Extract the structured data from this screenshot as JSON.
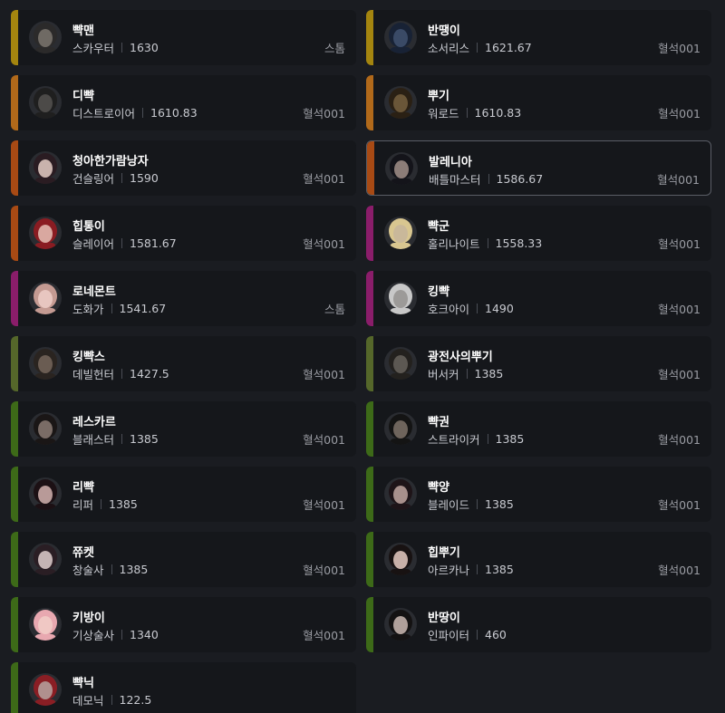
{
  "colors": {
    "tier_gold": "#a4850f",
    "tier_orange": "#b1691a",
    "tier_rust": "#a84a14",
    "tier_purple": "#8a1d6a",
    "tier_olive": "#55672a",
    "tier_green": "#3d6a18"
  },
  "characters": [
    {
      "name": "뺙맨",
      "class": "스카우터",
      "level": "1630",
      "guild": "스톰",
      "tier": "tier_gold",
      "avatar_tone": "#6f6a64",
      "avatar_hair": "#2b2a2a",
      "selected": false
    },
    {
      "name": "반땡이",
      "class": "소서리스",
      "level": "1621.67",
      "guild": "혈석001",
      "tier": "tier_gold",
      "avatar_tone": "#3a4a66",
      "avatar_hair": "#182235",
      "selected": false
    },
    {
      "name": "디뺙",
      "class": "디스트로이어",
      "level": "1610.83",
      "guild": "혈석001",
      "tier": "tier_orange",
      "avatar_tone": "#4c4a48",
      "avatar_hair": "#1f1f1f",
      "selected": false
    },
    {
      "name": "뿌기",
      "class": "워로드",
      "level": "1610.83",
      "guild": "혈석001",
      "tier": "tier_orange",
      "avatar_tone": "#6a5638",
      "avatar_hair": "#2a2014",
      "selected": false
    },
    {
      "name": "청아한가람낭자",
      "class": "건슬링어",
      "level": "1590",
      "guild": "혈석001",
      "tier": "tier_rust",
      "avatar_tone": "#c9b3ad",
      "avatar_hair": "#2a1c22",
      "selected": false
    },
    {
      "name": "발레니아",
      "class": "배틀마스터",
      "level": "1586.67",
      "guild": "혈석001",
      "tier": "tier_rust",
      "avatar_tone": "#8c7d78",
      "avatar_hair": "#14141a",
      "selected": true
    },
    {
      "name": "힙통이",
      "class": "슬레이어",
      "level": "1581.67",
      "guild": "혈석001",
      "tier": "tier_rust",
      "avatar_tone": "#d9a8a0",
      "avatar_hair": "#8a1c22",
      "selected": false
    },
    {
      "name": "뺙군",
      "class": "홀리나이트",
      "level": "1558.33",
      "guild": "혈석001",
      "tier": "tier_purple",
      "avatar_tone": "#c9b89a",
      "avatar_hair": "#d8c690",
      "selected": false
    },
    {
      "name": "로네몬트",
      "class": "도화가",
      "level": "1541.67",
      "guild": "스톰",
      "tier": "tier_purple",
      "avatar_tone": "#e8c6c0",
      "avatar_hair": "#c49a92",
      "selected": false
    },
    {
      "name": "킹뺙",
      "class": "호크아이",
      "level": "1490",
      "guild": "혈석001",
      "tier": "tier_purple",
      "avatar_tone": "#9c9a98",
      "avatar_hair": "#c8c8c8",
      "selected": false
    },
    {
      "name": "킹뺙스",
      "class": "데빌헌터",
      "level": "1427.5",
      "guild": "혈석001",
      "tier": "tier_olive",
      "avatar_tone": "#6a5c52",
      "avatar_hair": "#2a2420",
      "selected": false
    },
    {
      "name": "광전사의뿌기",
      "class": "버서커",
      "level": "1385",
      "guild": "혈석001",
      "tier": "tier_olive",
      "avatar_tone": "#5c5852",
      "avatar_hair": "#23211e",
      "selected": false
    },
    {
      "name": "레스카르",
      "class": "블래스터",
      "level": "1385",
      "guild": "혈석001",
      "tier": "tier_green",
      "avatar_tone": "#7a6c66",
      "avatar_hair": "#1a1616",
      "selected": false
    },
    {
      "name": "뺙권",
      "class": "스트라이커",
      "level": "1385",
      "guild": "혈석001",
      "tier": "tier_green",
      "avatar_tone": "#6e645c",
      "avatar_hair": "#141414",
      "selected": false
    },
    {
      "name": "리뺙",
      "class": "리퍼",
      "level": "1385",
      "guild": "혈석001",
      "tier": "tier_green",
      "avatar_tone": "#b89a98",
      "avatar_hair": "#1c1014",
      "selected": false
    },
    {
      "name": "뺙양",
      "class": "블레이드",
      "level": "1385",
      "guild": "혈석001",
      "tier": "tier_green",
      "avatar_tone": "#a8908c",
      "avatar_hair": "#1e1418",
      "selected": false
    },
    {
      "name": "쮸켓",
      "class": "창술사",
      "level": "1385",
      "guild": "혈석001",
      "tier": "tier_green",
      "avatar_tone": "#c4b4b4",
      "avatar_hair": "#2a1e24",
      "selected": false
    },
    {
      "name": "힙뿌기",
      "class": "아르카나",
      "level": "1385",
      "guild": "혈석001",
      "tier": "tier_green",
      "avatar_tone": "#c8b0a8",
      "avatar_hair": "#181212",
      "selected": false
    },
    {
      "name": "키방이",
      "class": "기상술사",
      "level": "1340",
      "guild": "혈석001",
      "tier": "tier_green",
      "avatar_tone": "#f0c8c4",
      "avatar_hair": "#e8a8b0",
      "selected": false
    },
    {
      "name": "반땅이",
      "class": "인파이터",
      "level": "460",
      "guild": "",
      "tier": "tier_green",
      "avatar_tone": "#b0a09a",
      "avatar_hair": "#141212",
      "selected": false
    },
    {
      "name": "뺙닉",
      "class": "데모닉",
      "level": "122.5",
      "guild": "",
      "tier": "tier_green",
      "avatar_tone": "#b0908e",
      "avatar_hair": "#8a1e24",
      "selected": false
    }
  ]
}
